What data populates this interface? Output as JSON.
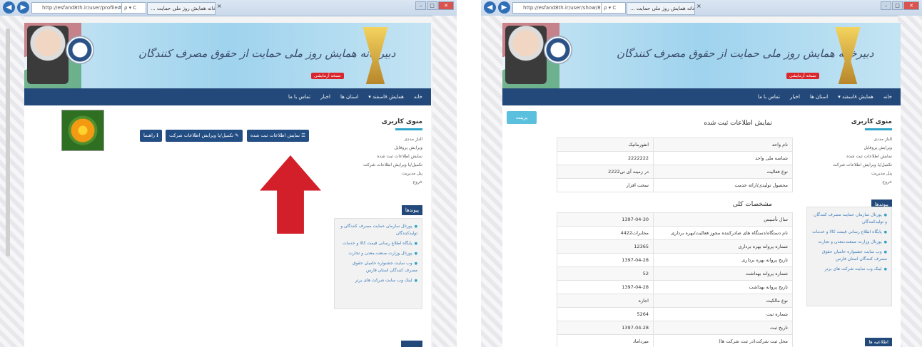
{
  "left": {
    "browser": {
      "url": "http://esfand8th.ir/user/profile#",
      "search_hint": "ρ ▾ C",
      "tab_title": "... دبیرخانه همایش روز ملی حمایت",
      "close": "×"
    },
    "banner": {
      "title": "دبیرخانه همایش روز ملی حمایت از حقوق مصرف کنندگان",
      "badge": "نسخه آزمایشی"
    },
    "nav": {
      "items": [
        "خانه",
        "همایش ۸اسفند ▾",
        "استان ها",
        "اخبار",
        "تماس با ما"
      ]
    },
    "user_menu": {
      "title": "منوی کاربری",
      "items": [
        "الناز مددی",
        "ویرایش پروفایل",
        "نمایش اطلاعات ثبت شده",
        "تکمیل/یا ویرایش اطلاعات شرکت",
        "پنل مدیریت",
        "خروج"
      ]
    },
    "links": {
      "title": "پیوندها",
      "items": [
        "پورتال سازمان حمایت مصرف کنندگان و تولیدکنندگان",
        "پایگاه اطلاع رسانی قیمت کالا و خدمات",
        "پورتال وزارت صنعت،معدن و تجارت",
        "وب سایت جشنواره حامیان حقوق مصرف کنندگان استان فارس",
        "لینک وب سایت شرکت های برتر"
      ]
    },
    "buttons": {
      "show_info": "☰ نمایش اطلاعات ثبت شده",
      "edit_company": "✎ تکمیل/یا ویرایش اطلاعات شرکت",
      "guide": "ℹ راهنما"
    }
  },
  "right": {
    "browser": {
      "url": "http://esfand8th.ir/user/show/824",
      "search_hint": "ρ ▾ C",
      "tab_title": "... دبیرخانه همایش روز ملی حمایت",
      "close": "×"
    },
    "banner": {
      "title": "دبیرخانه همایش روز ملی حمایت از حقوق مصرف کنندگان",
      "badge": "نسخه آزمایشی"
    },
    "nav": {
      "items": [
        "خانه",
        "همایش ۸اسفند ▾",
        "استان ها",
        "اخبار",
        "تماس با ما"
      ]
    },
    "user_menu": {
      "title": "منوی کاربری",
      "items": [
        "الناز مددی",
        "ویرایش پروفایل",
        "نمایش اطلاعات ثبت شده",
        "تکمیل/یا ویرایش اطلاعات شرکت",
        "پنل مدیریت",
        "خروج"
      ]
    },
    "links": {
      "title": "پیوندها",
      "items": [
        "پورتال سازمان حمایت مصرف کنندگان و تولیدکنندگان",
        "پایگاه اطلاع رسانی قیمت کالا و خدمات",
        "پورتال وزارت صنعت،معدن و تجارت",
        "وب سایت جشنواره حامیان حقوق مصرف کنندگان استان فارس",
        "لینک وب سایت شرکت های برتر"
      ]
    },
    "print_button": "پرینت",
    "section1_title": "نمایش اطلاعات ثبت شده",
    "table1": [
      [
        "نام واحد",
        "انفورماتیک"
      ],
      [
        "شناسه ملی واحد",
        "2222222"
      ],
      [
        "نوع فعالیت",
        "در زمینه آی تی2222"
      ],
      [
        "محصول تولیدی/ارائه خدمت",
        "سخت افزار"
      ]
    ],
    "section2_title": "مشخصات کلی",
    "table2": [
      [
        "سال تأسیس",
        "1397-04-30"
      ],
      [
        "نام دستگاه/دستگاه های صادرکننده مجوز فعالیت/بهره برداری",
        "مخابرات4422"
      ],
      [
        "شماره پروانه بهره برداری",
        "12365"
      ],
      [
        "تاریخ پروانه بهره برداری",
        "1397-04-28"
      ],
      [
        "شماره پروانه بهداشت",
        "52"
      ],
      [
        "تاریخ پروانه بهداشت",
        "1397-04-28"
      ],
      [
        "نوع مالکیت",
        "اجاره"
      ],
      [
        "شماره ثبت",
        "5264"
      ],
      [
        "تاریخ ثبت",
        "1397-04-28"
      ],
      [
        "محل ثبت شرکت(در ثبت شرکت ها)",
        "میرداماد"
      ]
    ],
    "news_title": "اطلاعیه ها"
  },
  "colors": {
    "navbar": "#23497a",
    "accent": "#2fa4c8",
    "arrow": "#d31f2a",
    "print": "#5bc0de"
  }
}
